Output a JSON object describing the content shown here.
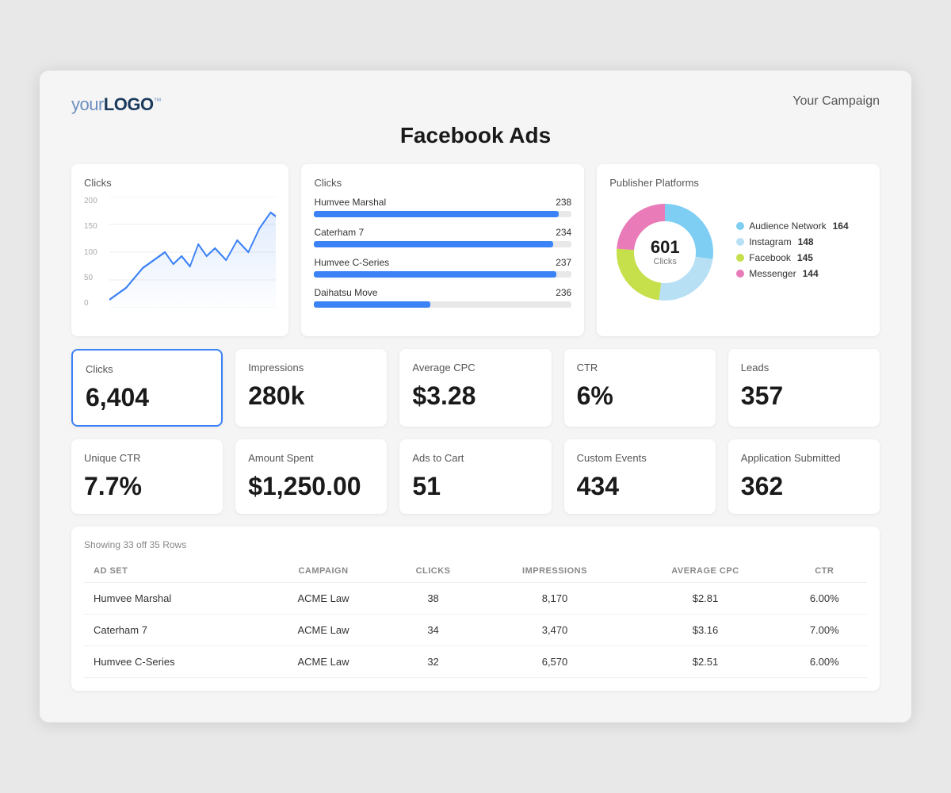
{
  "header": {
    "logo": "yourLOGO™",
    "logo_your": "your",
    "logo_bold": "LOGO",
    "logo_tm": "™",
    "campaign": "Your Campaign",
    "title": "Facebook Ads"
  },
  "line_chart": {
    "title": "Clicks",
    "y_labels": [
      "200",
      "150",
      "100",
      "50",
      "0"
    ]
  },
  "bar_chart": {
    "title": "Clicks",
    "items": [
      {
        "label": "Humvee Marshal",
        "value": 238,
        "pct": 95
      },
      {
        "label": "Caterham 7",
        "value": 234,
        "pct": 93
      },
      {
        "label": "Humvee C-Series",
        "value": 237,
        "pct": 94
      },
      {
        "label": "Daihatsu Move",
        "value": 236,
        "pct": 45
      }
    ]
  },
  "donut_chart": {
    "title": "Publisher Platforms",
    "center_number": "601",
    "center_label": "Clicks",
    "legend": [
      {
        "label": "Audience Network",
        "value": "164",
        "color": "#7ecef4"
      },
      {
        "label": "Instagram",
        "value": "148",
        "color": "#b8e0f5"
      },
      {
        "label": "Facebook",
        "value": "145",
        "color": "#c5e04a"
      },
      {
        "label": "Messenger",
        "value": "144",
        "color": "#e87bb8"
      }
    ]
  },
  "metrics_row1": [
    {
      "id": "clicks",
      "label": "Clicks",
      "value": "6,404",
      "active": true
    },
    {
      "id": "impressions",
      "label": "Impressions",
      "value": "280k",
      "active": false
    },
    {
      "id": "avg-cpc",
      "label": "Average CPC",
      "value": "$3.28",
      "active": false
    },
    {
      "id": "ctr",
      "label": "CTR",
      "value": "6%",
      "active": false
    },
    {
      "id": "leads",
      "label": "Leads",
      "value": "357",
      "active": false
    }
  ],
  "metrics_row2": [
    {
      "id": "unique-ctr",
      "label": "Unique CTR",
      "value": "7.7%",
      "active": false
    },
    {
      "id": "amount-spent",
      "label": "Amount Spent",
      "value": "$1,250.00",
      "active": false
    },
    {
      "id": "ads-cart",
      "label": "Ads to Cart",
      "value": "51",
      "active": false
    },
    {
      "id": "custom-events",
      "label": "Custom Events",
      "value": "434",
      "active": false
    },
    {
      "id": "app-submitted",
      "label": "Application Submitted",
      "value": "362",
      "active": false
    }
  ],
  "table": {
    "meta": "Showing 33 off 35 Rows",
    "columns": [
      "AD SET",
      "CAMPAIGN",
      "CLICKS",
      "IMPRESSIONS",
      "AVERAGE CPC",
      "CTR"
    ],
    "rows": [
      {
        "ad_set": "Humvee Marshal",
        "campaign": "ACME Law",
        "clicks": "38",
        "impressions": "8,170",
        "avg_cpc": "$2.81",
        "ctr": "6.00%"
      },
      {
        "ad_set": "Caterham 7",
        "campaign": "ACME Law",
        "clicks": "34",
        "impressions": "3,470",
        "avg_cpc": "$3.16",
        "ctr": "7.00%"
      },
      {
        "ad_set": "Humvee C-Series",
        "campaign": "ACME Law",
        "clicks": "32",
        "impressions": "6,570",
        "avg_cpc": "$2.51",
        "ctr": "6.00%"
      }
    ]
  }
}
